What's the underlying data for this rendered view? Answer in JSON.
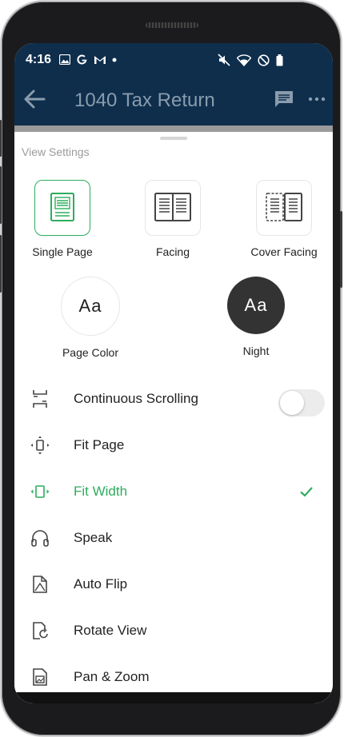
{
  "status": {
    "time": "4:16"
  },
  "header": {
    "title": "1040 Tax Return"
  },
  "sheet": {
    "title": "View Settings",
    "layouts": [
      {
        "label": "Single Page",
        "active": true
      },
      {
        "label": "Facing",
        "active": false
      },
      {
        "label": "Cover Facing",
        "active": false
      }
    ],
    "themes": [
      {
        "label": "Page Color",
        "sample": "Aa"
      },
      {
        "label": "Night",
        "sample": "Aa"
      }
    ],
    "options": [
      {
        "label": "Continuous Scrolling",
        "icon": "continuous-scroll-icon",
        "toggle": false
      },
      {
        "label": "Fit Page",
        "icon": "fit-page-icon"
      },
      {
        "label": "Fit Width",
        "icon": "fit-width-icon",
        "selected": true
      },
      {
        "label": "Speak",
        "icon": "headphones-icon"
      },
      {
        "label": "Auto Flip",
        "icon": "auto-flip-icon"
      },
      {
        "label": "Rotate View",
        "icon": "rotate-view-icon"
      },
      {
        "label": "Pan & Zoom",
        "icon": "pan-zoom-icon"
      }
    ]
  },
  "colors": {
    "accent": "#2dad5e",
    "appbar": "#0e2e4c",
    "night": "#333333"
  }
}
